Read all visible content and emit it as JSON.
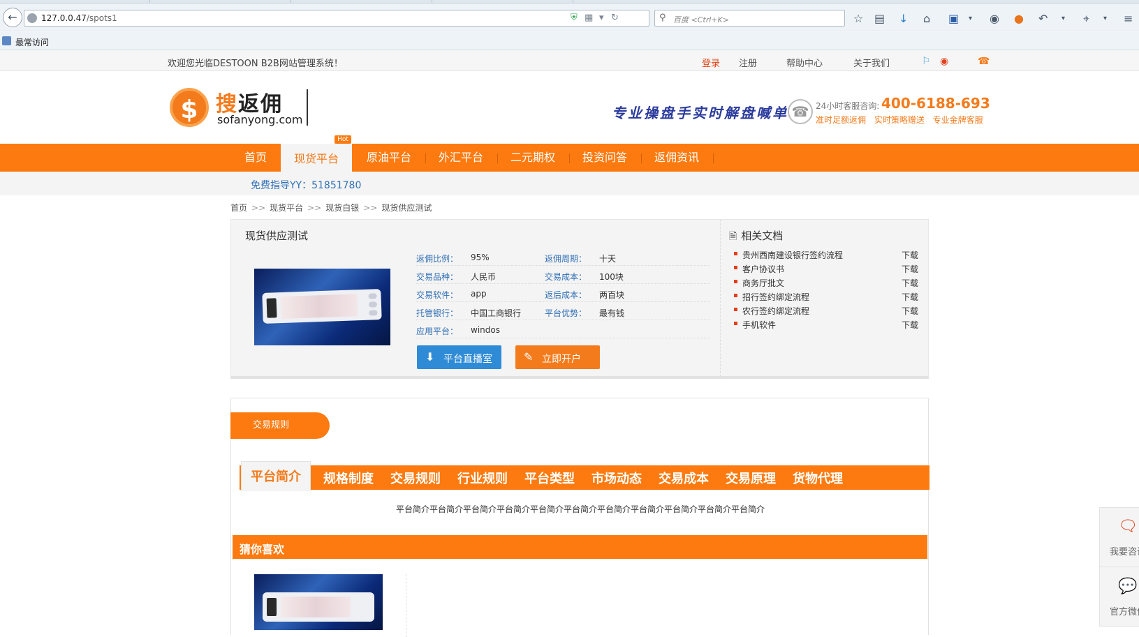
{
  "browser": {
    "url_host": "127.0.0.47",
    "url_path": "/spots1",
    "search_placeholder": "百度 <Ctrl+K>",
    "bookmark_label": "最常访问"
  },
  "topbar": {
    "welcome": "欢迎您光临DESTOON B2B网站管理系统！",
    "links": [
      "登录",
      "注册",
      "帮助中心",
      "关于我们"
    ]
  },
  "header": {
    "logo_cn_char": "搜",
    "logo_cn_rest": "返佣",
    "logo_en": "sofanyong.com",
    "slogan": "专业操盘手实时解盘喊单",
    "hotline_label": "24小时客服咨询:",
    "hotline_number": "400-6188-693",
    "hotline_tags": "准时足额返佣 实时策略赠送 专业金牌客服"
  },
  "nav": {
    "items": [
      "首页",
      "现货平台",
      "原油平台",
      "外汇平台",
      "二元期权",
      "投资问答",
      "返佣资讯"
    ],
    "hot_badge": "Hot",
    "accent_color": "#fc7a0f"
  },
  "guide": {
    "text": "免费指导YY：51851780"
  },
  "breadcrumb": [
    "首页",
    "现货平台",
    "现货白银",
    "现货供应测试"
  ],
  "product": {
    "title": "现货供应测试",
    "specs": [
      {
        "k1": "返佣比例：",
        "v1": "95%",
        "k2": "返佣周期：",
        "v2": "十天"
      },
      {
        "k1": "交易品种：",
        "v1": "人民币",
        "k2": "交易成本：",
        "v2": "100块"
      },
      {
        "k1": "交易软件：",
        "v1": "app",
        "k2": "返后成本：",
        "v2": "两百块"
      },
      {
        "k1": "托管银行：",
        "v1": "中国工商银行",
        "k2": "平台优势：",
        "v2": "最有钱"
      },
      {
        "k1": "应用平台：",
        "v1": "windos",
        "k2": "",
        "v2": ""
      }
    ],
    "btn_live": "平台直播室",
    "btn_open": "立即开户"
  },
  "docs": {
    "title": "相关文档",
    "items": [
      {
        "name": "贵州西南建设银行签约流程",
        "action": "下载"
      },
      {
        "name": "客户协议书",
        "action": "下载"
      },
      {
        "name": "商务厅批文",
        "action": "下载"
      },
      {
        "name": "招行签约绑定流程",
        "action": "下载"
      },
      {
        "name": "农行签约绑定流程",
        "action": "下载"
      },
      {
        "name": "手机软件",
        "action": "下载"
      }
    ]
  },
  "rules": {
    "pill": "交易规则",
    "tabs": [
      "平台简介",
      "规格制度",
      "交易规则",
      "行业规则",
      "平台类型",
      "市场动态",
      "交易成本",
      "交易原理",
      "货物代理"
    ],
    "content": "平台简介平台简介平台简介平台简介平台简介平台简介平台简介平台简介平台简介平台简介平台简介",
    "guess_title": "猜你喜欢"
  },
  "side": {
    "consult": "我要咨询",
    "wechat": "官方微信"
  }
}
